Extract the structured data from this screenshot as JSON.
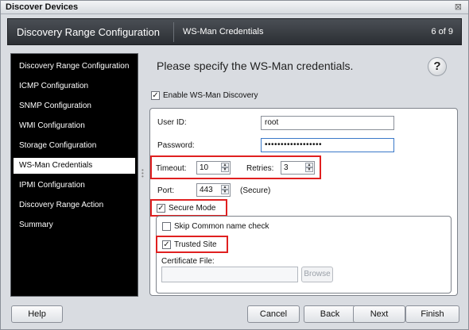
{
  "window": {
    "title": "Discover Devices",
    "close_glyph": "⊠"
  },
  "header": {
    "section": "Discovery Range Configuration",
    "page": "WS-Man Credentials",
    "step": "6 of 9"
  },
  "nav": {
    "items": [
      "Discovery Range Configuration",
      "ICMP Configuration",
      "SNMP Configuration",
      "WMI Configuration",
      "Storage Configuration",
      "WS-Man Credentials",
      "IPMI Configuration",
      "Discovery Range Action",
      "Summary"
    ],
    "active_index": 5
  },
  "content": {
    "heading": "Please specify the WS-Man credentials.",
    "help_glyph": "?",
    "enable_label": "Enable WS-Man Discovery",
    "enable_checked": true,
    "user_id_label": "User ID:",
    "user_id_value": "root",
    "password_label": "Password:",
    "password_value": "••••••••••••••••••",
    "timeout_label": "Timeout:",
    "timeout_value": "10",
    "retries_label": "Retries:",
    "retries_value": "3",
    "port_label": "Port:",
    "port_value": "443",
    "port_note": "(Secure)",
    "secure_mode_label": "Secure Mode",
    "secure_mode_checked": true,
    "skip_cn_label": "Skip Common  name check",
    "skip_cn_checked": false,
    "trusted_site_label": "Trusted Site",
    "trusted_site_checked": true,
    "cert_file_label": "Certificate File:",
    "cert_file_value": "",
    "browse_label": "Browse"
  },
  "footer": {
    "help": "Help",
    "cancel": "Cancel",
    "back": "Back",
    "next": "Next",
    "finish": "Finish"
  },
  "colors": {
    "highlight": "#e02020",
    "header_bg": "#2b2e33",
    "nav_bg": "#000000"
  }
}
